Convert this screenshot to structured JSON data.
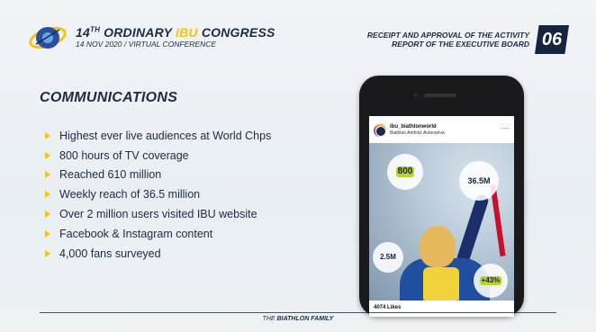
{
  "header": {
    "title_prefix": "14",
    "title_sup": "TH",
    "title_mid": " ORDINARY ",
    "title_ibu": "IBU",
    "title_suffix": " CONGRESS",
    "subtitle": "14 NOV 2020 / VIRTUAL CONFERENCE",
    "report_line1": "RECEIPT AND APPROVAL OF THE ACTIVITY",
    "report_line2": "REPORT OF THE EXECUTIVE BOARD",
    "slide_number": "06"
  },
  "section_title": "COMMUNICATIONS",
  "bullets": [
    "Highest ever live audiences at World Chps",
    "800 hours of TV coverage",
    "Reached 610 million",
    "Weekly reach of 36.5 million",
    "Over 2 million users visited IBU website",
    "Facebook & Instagram content",
    "4,000 fans surveyed"
  ],
  "instagram": {
    "username": "ibu_biathlonworld",
    "location": "Biathlon Antholz Anterselva",
    "more": "···",
    "likes": "4074 Likes",
    "stats": [
      {
        "value": "800"
      },
      {
        "value": "36.5M"
      },
      {
        "value": "2.5M"
      },
      {
        "value": "+43%"
      }
    ]
  },
  "footer": {
    "prefix": "THE ",
    "bold": "BIATHLON FAMILY"
  },
  "colors": {
    "navy": "#1c2a44",
    "yellow": "#f2c417",
    "green_accent": "#b9d42c",
    "background": "#eef2f5"
  }
}
